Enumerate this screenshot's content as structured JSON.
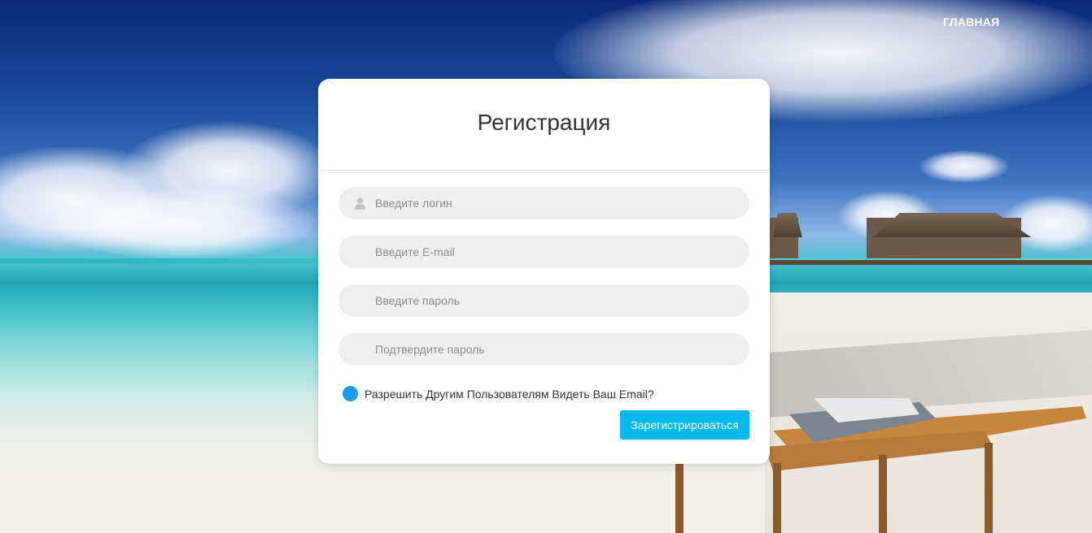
{
  "nav": {
    "home_label": "ГЛАВНАЯ"
  },
  "form": {
    "title": "Регистрация",
    "login_placeholder": "Введите логин",
    "email_placeholder": "Введите E-mail",
    "password_placeholder": "Введите пароль",
    "confirm_placeholder": "Подтвердите пароль",
    "share_email_label": "Разрешить Другим Пользователям Видеть Ваш Email?",
    "share_email_checked": true,
    "submit_label": "Зарегистрироваться"
  },
  "colors": {
    "accent": "#06b8ec",
    "checkbox": "#1a9cf0",
    "field_bg": "#efefef",
    "card_bg": "#ffffff"
  },
  "icons": {
    "login_field": "user-icon"
  }
}
